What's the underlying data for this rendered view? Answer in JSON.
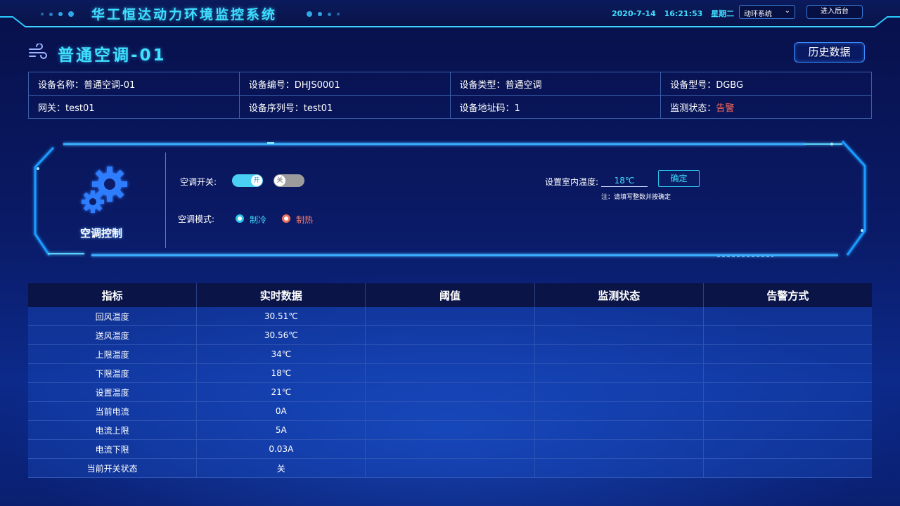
{
  "header": {
    "title": "华工恒达动力环境监控系统",
    "date": "2020-7-14",
    "time": "16:21:53",
    "weekday": "星期二",
    "system_select": "动环系统",
    "enter_backend": "进入后台"
  },
  "device": {
    "title": "普通空调-01",
    "history_button": "历史数据",
    "info": {
      "name": "设备名称：普通空调-01",
      "code": "设备编号：DHJS0001",
      "type": "设备类型：普通空调",
      "model": "设备型号：DGBG",
      "gateway": "网关：test01",
      "serial": "设备序列号：test01",
      "address": "设备地址码：1",
      "status_label": "监测状态：",
      "status_value": "告警"
    }
  },
  "control": {
    "title": "空调控制",
    "switch_label": "空调开关:",
    "on_label": "开",
    "off_label": "关",
    "mode_label": "空调模式:",
    "mode_cool": "制冷",
    "mode_heat": "制热",
    "temp_label": "设置室内温度:",
    "temp_value": "18℃",
    "confirm": "确定",
    "note": "注：请填写整数并按确定"
  },
  "colors": {
    "accent": "#3fe0ff",
    "warning": "#ff6b5b",
    "cool": "#2bc4ef",
    "heat": "#f07060"
  },
  "table": {
    "headers": [
      "指标",
      "实时数据",
      "阈值",
      "监测状态",
      "告警方式"
    ],
    "rows": [
      [
        "回风温度",
        "30.51℃",
        "",
        "",
        ""
      ],
      [
        "送风温度",
        "30.56℃",
        "",
        "",
        ""
      ],
      [
        "上限温度",
        "34℃",
        "",
        "",
        ""
      ],
      [
        "下限温度",
        "18℃",
        "",
        "",
        ""
      ],
      [
        "设置温度",
        "21℃",
        "",
        "",
        ""
      ],
      [
        "当前电流",
        "0A",
        "",
        "",
        ""
      ],
      [
        "电流上限",
        "5A",
        "",
        "",
        ""
      ],
      [
        "电流下限",
        "0.03A",
        "",
        "",
        ""
      ],
      [
        "当前开关状态",
        "关",
        "",
        "",
        ""
      ]
    ]
  }
}
